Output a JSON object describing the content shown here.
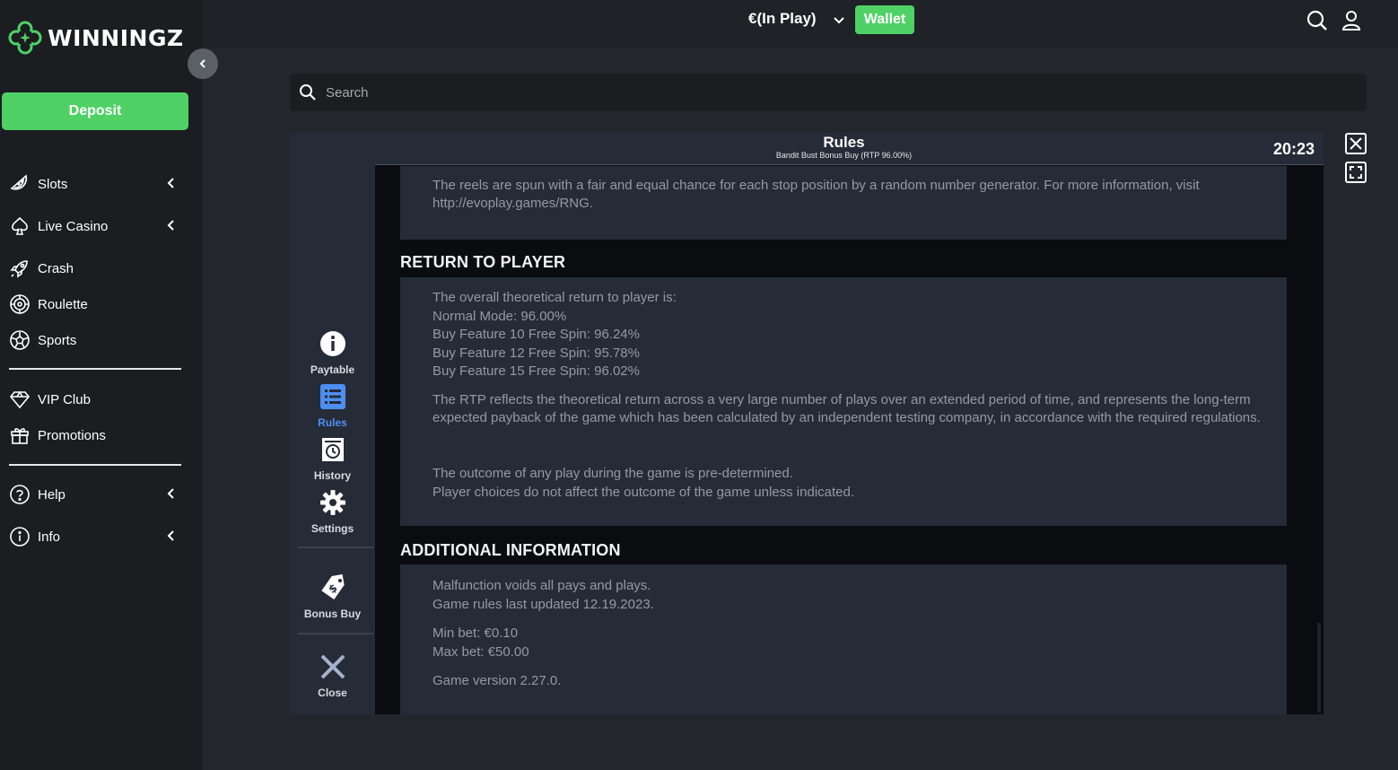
{
  "brand": {
    "name": "WINNINGZ",
    "accent": "#4fd166"
  },
  "sidebar": {
    "deposit_label": "Deposit",
    "items": [
      {
        "label": "Slots",
        "icon": "watermelon-icon",
        "has_chevron": true
      },
      {
        "label": "Live Casino",
        "icon": "spade-icon",
        "has_chevron": true
      },
      {
        "label": "Crash",
        "icon": "rocket-icon",
        "has_chevron": false
      },
      {
        "label": "Roulette",
        "icon": "roulette-icon",
        "has_chevron": false
      },
      {
        "label": "Sports",
        "icon": "soccer-ball-icon",
        "has_chevron": false
      },
      {
        "label": "VIP Club",
        "icon": "diamond-icon",
        "has_chevron": false
      },
      {
        "label": "Promotions",
        "icon": "gift-icon",
        "has_chevron": false
      },
      {
        "label": "Help",
        "icon": "question-icon",
        "has_chevron": true
      },
      {
        "label": "Info",
        "icon": "info-icon",
        "has_chevron": true
      }
    ]
  },
  "topbar": {
    "balance": "€(In Play)",
    "wallet_label": "Wallet"
  },
  "search": {
    "placeholder": "Search"
  },
  "game": {
    "menu": [
      {
        "label": "Paytable",
        "icon": "info-circle-icon",
        "active": false
      },
      {
        "label": "Rules",
        "icon": "list-icon",
        "active": true
      },
      {
        "label": "History",
        "icon": "history-icon",
        "active": false
      },
      {
        "label": "Settings",
        "icon": "gear-icon",
        "active": false
      },
      {
        "label": "Bonus Buy",
        "icon": "price-tag-icon",
        "active": false
      },
      {
        "label": "Close",
        "icon": "close-icon",
        "active": false
      }
    ],
    "header": {
      "title": "Rules",
      "subtitle": "Bandit Bust Bonus Buy (RTP 96.00%)",
      "clock": "20:23"
    },
    "rng_text": "The reels are spun with a fair and equal chance for each stop position by a random number generator. For more information, visit http://evoplay.games/RNG.",
    "rtp": {
      "title": "RETURN TO PLAYER",
      "lines": [
        "The overall theoretical return to player is:",
        "Normal Mode: 96.00%",
        "Buy Feature 10 Free Spin: 96.24%",
        "Buy Feature 12 Free Spin: 95.78%",
        "Buy Feature 15 Free Spin: 96.02%"
      ],
      "explanation": "The RTP reflects the theoretical return across a very large number of plays over an extended period of time, and represents the long-term expected payback of the game which has been calculated by an independent testing company, in accordance with the required regulations.",
      "outcome": [
        "The outcome of any play during the game is pre-determined.",
        "Player choices do not affect the outcome of the game unless indicated."
      ]
    },
    "additional": {
      "title": "ADDITIONAL INFORMATION",
      "malfunction": [
        "Malfunction voids all pays and plays.",
        "Game rules last updated 12.19.2023."
      ],
      "bets": [
        "Min bet: €0.10",
        "Max bet: €50.00"
      ],
      "version": "Game version 2.27.0."
    }
  }
}
